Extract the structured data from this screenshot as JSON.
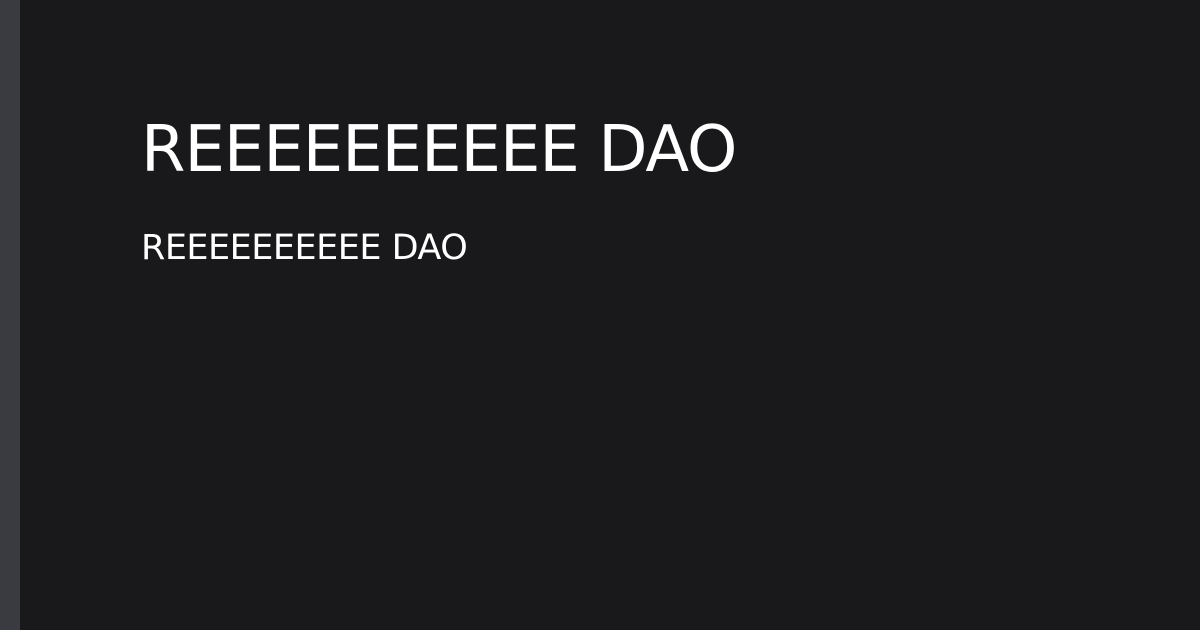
{
  "card": {
    "title": "REEEEEEEEEE DAO",
    "description": "REEEEEEEEEE DAO"
  },
  "colors": {
    "background": "#19191b",
    "accent_bar": "#3a3b40",
    "text": "#ffffff"
  }
}
